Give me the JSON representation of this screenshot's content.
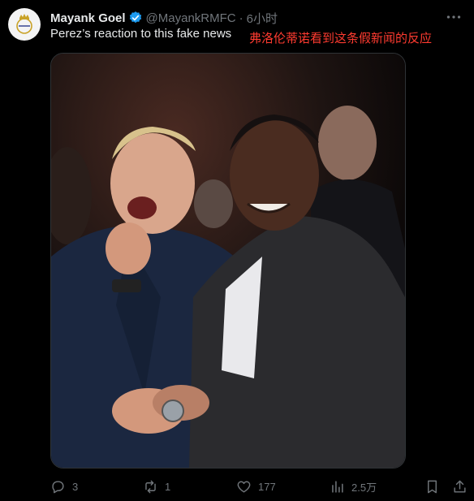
{
  "tweet": {
    "author": {
      "name": "Mayank Goel",
      "handle": "@MayankRMFC",
      "dot": "·",
      "time": "6小时",
      "avatar_icon": "real-madrid-crest-icon",
      "verified_icon": "verified-badge-icon"
    },
    "text": "Perez’s reaction to this fake news",
    "translation": "弗洛伦蒂诺看到这条假新闻的反应",
    "media": {
      "kind": "photo"
    },
    "actions": {
      "reply": {
        "icon": "reply-icon",
        "count": "3"
      },
      "retweet": {
        "icon": "retweet-icon",
        "count": "1"
      },
      "like": {
        "icon": "heart-icon",
        "count": "177"
      },
      "views": {
        "icon": "views-chart-icon",
        "count": "2.5万"
      },
      "bookmark": {
        "icon": "bookmark-icon"
      },
      "share": {
        "icon": "share-icon"
      }
    },
    "more_icon": "more-options-icon"
  },
  "colors": {
    "background": "#000000",
    "text": "#e7e9ea",
    "muted": "#71767b",
    "verified": "#1d9bf0",
    "translation": "#ff3b30"
  }
}
